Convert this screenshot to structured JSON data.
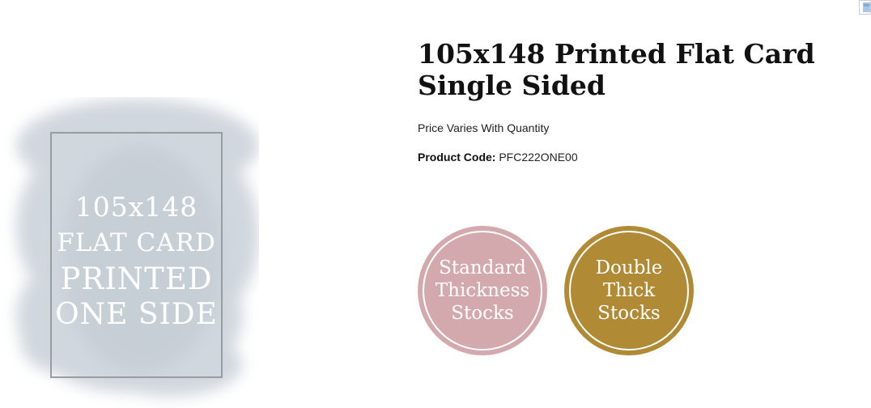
{
  "product": {
    "title": "105x148 Printed Flat Card Single Sided",
    "price_note": "Price Varies With Quantity",
    "code_label": "Product Code:",
    "code_value": "PFC222ONE00"
  },
  "image": {
    "lines": [
      "105x148",
      "FLAT CARD",
      "PRINTED",
      "ONE SIDE"
    ]
  },
  "badges": [
    {
      "lines": [
        "Standard",
        "Thickness",
        "Stocks"
      ],
      "color": "#d4a9ad"
    },
    {
      "lines": [
        "Double",
        "Thick",
        "Stocks"
      ],
      "color": "#b18a35"
    }
  ],
  "icons": {
    "corner": "image-icon"
  }
}
